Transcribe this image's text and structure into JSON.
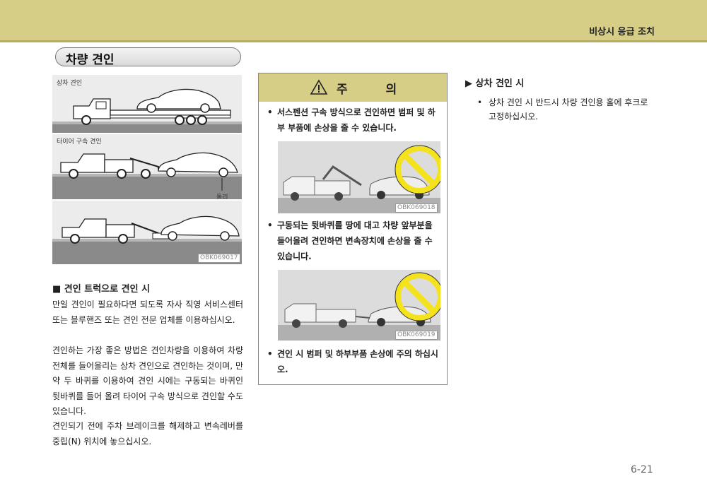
{
  "header": {
    "section_label": "비상시 응급 조치"
  },
  "page_title": "차량 견인",
  "figure": {
    "flatbed_label": "상차 견인",
    "wheel_lift_label": "타이어 구속 견인",
    "dolly_label": "돌리",
    "code": "OBK069017"
  },
  "left_section": {
    "heading": "■ 견인 트럭으로 견인 시",
    "paragraphs": [
      "만일 견인이 필요하다면 되도록 자사 직영 서비스센터 또는 블루핸즈 또는 견인 전문 업체를 이용하십시오.",
      "견인하는 가장 좋은 방법은 견인차량을 이용하여 차량 전체를 들어올리는 상차 견인으로 견인하는 것이며, 만약 두 바퀴를 이용하여 견인 시에는 구동되는 바퀴인 뒷바퀴를 들어 올려 타이어 구속 방식으로 견인할 수도 있습니다.",
      "견인되기 전에 주차 브레이크를 해제하고 변속레버를 중립(N) 위치에 놓으십시오."
    ]
  },
  "caution": {
    "title": "주 의",
    "bullet": "•",
    "items": [
      "서스펜션 구속 방식으로 견인하면 범퍼 및 하부 부품에 손상을 줄 수 있습니다.",
      "구동되는 뒷바퀴를 땅에 대고 차량 앞부분을 들어올려 견인하면 변속장치에 손상을 줄 수 있습니다.",
      "견인 시 범퍼 및 하부부품 손상에 주의 하십시오."
    ],
    "photo_codes": [
      "OBK069018",
      "OBK069019"
    ]
  },
  "right_section": {
    "heading": "▶ 상차 견인 시",
    "bullet": "•",
    "text": "상차 견인 시 반드시 차량 견인용 홀에 후크로 고정하십시오."
  },
  "page_number": "6-21",
  "colors": {
    "band": "#d6cd87",
    "prohibition": "#f4e21c"
  }
}
